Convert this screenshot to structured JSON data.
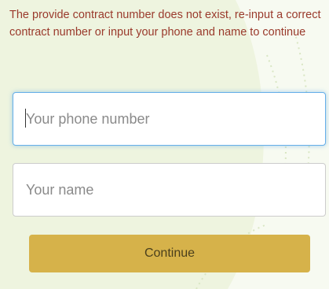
{
  "form": {
    "error_message": "The provide contract number does not exist, re-input a correct contract number or input your phone and name to continue",
    "phone": {
      "value": "",
      "placeholder": "Your phone number"
    },
    "name": {
      "value": "",
      "placeholder": "Your name"
    },
    "continue_label": "Continue"
  },
  "colors": {
    "background": "#eef4df",
    "error_text": "#9a3a2c",
    "button": "#d6b24a",
    "focus_border": "#66afe9"
  }
}
